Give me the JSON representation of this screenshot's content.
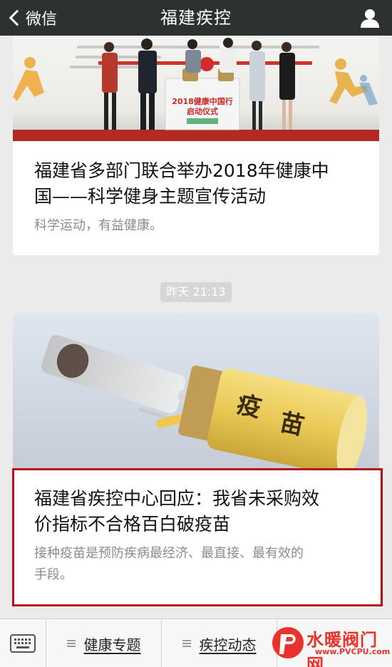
{
  "navbar": {
    "back_label": "微信",
    "title": "福建疾控"
  },
  "article1": {
    "photo_banner": "2018健康中国行",
    "photo_banner_2": "启动仪式",
    "title": "福建省多部门联合举办2018年健康中国——科学健身主题宣传活动",
    "title_line1": "福建省多部门联合举办2018年健康中",
    "title_line2": "国——科学健身主题宣传活动",
    "desc": "科学运动，有益健康。"
  },
  "timestamp": "昨天 21:13",
  "article2": {
    "photo_label_a": "疫",
    "photo_label_b": "苗",
    "title_line1": "福建省疾控中心回应：我省未采购效",
    "title_line2": "价指标不合格百白破疫苗",
    "desc_line1": "接种疫苗是预防疾病最经济、最直接、最有效的",
    "desc_line2": "手段。"
  },
  "menu": {
    "items": [
      {
        "label": "健康专题"
      },
      {
        "label": "疾控动态"
      }
    ]
  },
  "watermark": {
    "text": "水暖阀门网",
    "url": "www.PVCPU.com"
  },
  "colors": {
    "navbar": "#2e3132",
    "highlight": "#b5121b",
    "watermark": "#e8322b"
  }
}
